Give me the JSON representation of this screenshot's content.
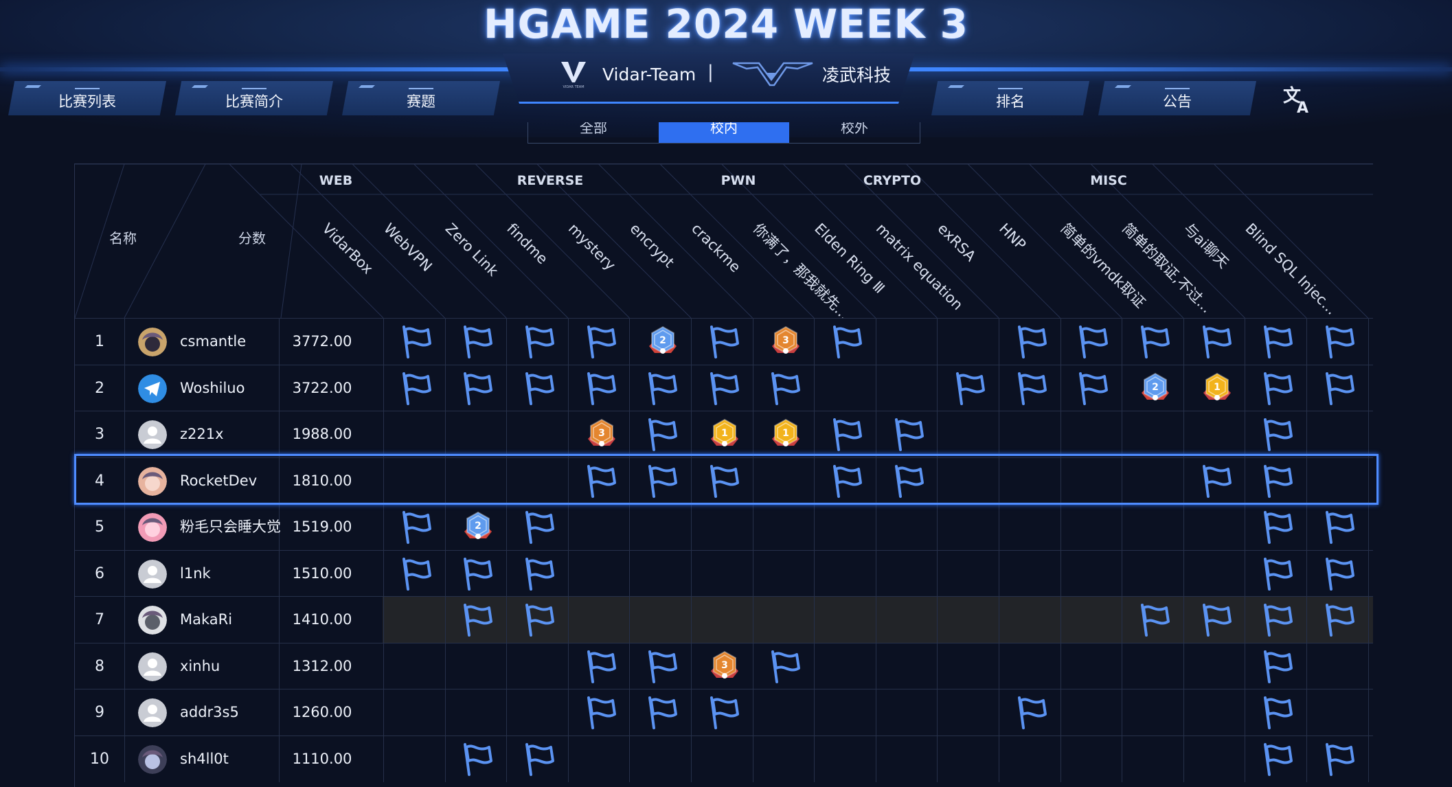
{
  "header": {
    "title": "HGAME 2024 WEEK 3",
    "org_name": "Vidar-Team",
    "separator": "|",
    "sponsor_name": "凌武科技",
    "logo_small_text": "VIDAR TEAM"
  },
  "nav": {
    "left": [
      "比赛列表",
      "比赛简介",
      "赛题"
    ],
    "right": [
      "排名",
      "公告"
    ],
    "translate_icon": "translate-icon"
  },
  "filter_tabs": {
    "items": [
      "全部",
      "校内",
      "校外"
    ],
    "active": "校内"
  },
  "table": {
    "name_header": "名称",
    "score_header": "分数",
    "categories": [
      "WEB",
      "REVERSE",
      "PWN",
      "CRYPTO",
      "MISC"
    ],
    "challenges": [
      "VidarBox",
      "WebVPN",
      "Zero Link",
      "findme",
      "mystery",
      "encrypt",
      "crackme",
      "你满了，那我就先走了",
      "Elden Ring Ⅲ",
      "matrix equation",
      "exRSA",
      "HNP",
      "简单的vmdk取证",
      "简单的取证,不过前十个",
      "与ai聊天",
      "Blind SQL Injection"
    ],
    "challenge_labels": [
      "VidarBox",
      "WebVPN",
      "Zero Link",
      "findme",
      "mystery",
      "encrypt",
      "crackme",
      "你满了，那我就先...",
      "Elden Ring Ⅲ",
      "matrix equation",
      "exRSA",
      "HNP",
      "简单的vmdk取证",
      "简单的取证,不过...",
      "与ai聊天",
      "Blind SQL Injec..."
    ],
    "rows": [
      {
        "rank": "1",
        "name": "csmantle",
        "score": "3772.00",
        "avatar": "avatar-anime",
        "solves": [
          "f",
          "f",
          "f",
          "f",
          "b2",
          "f",
          "b3",
          "f",
          "",
          "",
          "f",
          "f",
          "f",
          "f",
          "f",
          "f"
        ]
      },
      {
        "rank": "2",
        "name": "Woshiluo",
        "score": "3722.00",
        "avatar": "avatar-telegram",
        "solves": [
          "f",
          "f",
          "f",
          "f",
          "f",
          "f",
          "f",
          "",
          "",
          "f",
          "f",
          "f",
          "b2",
          "b1",
          "f",
          "f"
        ]
      },
      {
        "rank": "3",
        "name": "z221x",
        "score": "1988.00",
        "avatar": "avatar-default",
        "solves": [
          "",
          "",
          "",
          "b3",
          "f",
          "b1",
          "b1",
          "f",
          "f",
          "",
          "",
          "",
          "",
          "",
          "f",
          ""
        ]
      },
      {
        "rank": "4",
        "name": "RocketDev",
        "score": "1810.00",
        "avatar": "avatar-anime-pink",
        "solves": [
          "",
          "",
          "",
          "f",
          "f",
          "f",
          "",
          "f",
          "f",
          "",
          "",
          "",
          "",
          "f",
          "f",
          ""
        ]
      },
      {
        "rank": "5",
        "name": "粉毛只会睡大觉",
        "score": "1519.00",
        "avatar": "avatar-anime-pink2",
        "solves": [
          "f",
          "b2",
          "f",
          "",
          "",
          "",
          "",
          "",
          "",
          "",
          "",
          "",
          "",
          "",
          "f",
          "f"
        ]
      },
      {
        "rank": "6",
        "name": "l1nk",
        "score": "1510.00",
        "avatar": "avatar-default",
        "solves": [
          "f",
          "f",
          "f",
          "",
          "",
          "",
          "",
          "",
          "",
          "",
          "",
          "",
          "",
          "",
          "f",
          "f"
        ]
      },
      {
        "rank": "7",
        "name": "MakaRi",
        "score": "1410.00",
        "avatar": "avatar-anime-grey",
        "solves": [
          "",
          "f",
          "f",
          "",
          "",
          "",
          "",
          "",
          "",
          "",
          "",
          "",
          "f",
          "f",
          "f",
          "f"
        ]
      },
      {
        "rank": "8",
        "name": "xinhu",
        "score": "1312.00",
        "avatar": "avatar-default",
        "solves": [
          "",
          "",
          "",
          "f",
          "f",
          "b3",
          "f",
          "",
          "",
          "",
          "",
          "",
          "",
          "",
          "f",
          ""
        ]
      },
      {
        "rank": "9",
        "name": "addr3s5",
        "score": "1260.00",
        "avatar": "avatar-default",
        "solves": [
          "",
          "",
          "",
          "f",
          "f",
          "f",
          "",
          "",
          "",
          "",
          "f",
          "",
          "",
          "",
          "f",
          ""
        ]
      },
      {
        "rank": "10",
        "name": "sh4ll0t",
        "score": "1110.00",
        "avatar": "avatar-anime-dark",
        "solves": [
          "",
          "f",
          "f",
          "",
          "",
          "",
          "",
          "",
          "",
          "",
          "",
          "",
          "",
          "",
          "f",
          "f"
        ]
      }
    ],
    "highlighted_rank": "4"
  },
  "colors": {
    "flag": "#5b93f2",
    "accent": "#2f6ff0",
    "gold": "#f2b31c",
    "bronze": "#e4862f",
    "silver_blue": "#5f9bee"
  }
}
